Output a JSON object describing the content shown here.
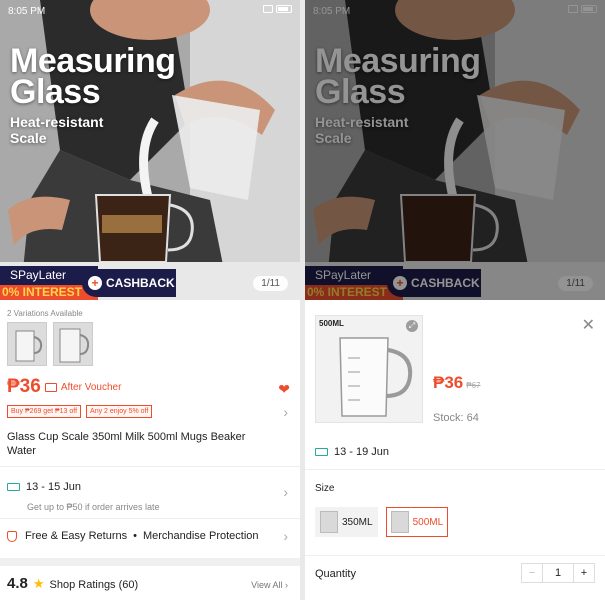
{
  "left": {
    "status_time": "8:05 PM",
    "hero": {
      "title_line1": "Measuring",
      "title_line2": "Glass",
      "subtitle_line1": "Heat-resistant",
      "subtitle_line2": "Scale",
      "promo_spay": "SPayLater",
      "promo_interest": "0% INTEREST",
      "promo_cashback": "CASHBACK",
      "counter": "1/11"
    },
    "variations_note": "2 Variations Available",
    "price": "₱36",
    "price_note": "After Voucher",
    "chips": [
      "Buy ₱269 get ₱13 off",
      "Any 2 enjoy 5% off"
    ],
    "product_title": "Glass Cup Scale 350ml Milk 500ml Mugs Beaker Water",
    "shipping": {
      "dates": "13 - 15 Jun",
      "note": "Get up to ₱50 if order arrives late"
    },
    "returns": "Free & Easy Returns",
    "protection": "Merchandise Protection",
    "ratings": {
      "score": "4.8",
      "label": "Shop Ratings (60)",
      "view_all": "View All"
    }
  },
  "right": {
    "status_time": "8:05 PM",
    "hero": {
      "title_line1": "Measuring",
      "title_line2": "Glass",
      "subtitle_line1": "Heat-resistant",
      "subtitle_line2": "Scale",
      "promo_spay": "SPayLater",
      "promo_interest": "0% INTEREST",
      "promo_cashback": "CASHBACK",
      "counter": "1/11"
    },
    "sheet": {
      "thumb_label": "500ML",
      "price": "₱36",
      "old_price": "₱67",
      "stock": "Stock: 64",
      "ship_dates": "13 - 19 Jun",
      "size_heading": "Size",
      "options": [
        "350ML",
        "500ML"
      ],
      "selected_option": "500ML",
      "quantity_label": "Quantity",
      "quantity_value": "1"
    }
  },
  "colors": {
    "accent": "#ee4d2d",
    "promo_navy": "#1c1c4a",
    "shipping_teal": "#26aa99",
    "star": "#ffbf00"
  }
}
